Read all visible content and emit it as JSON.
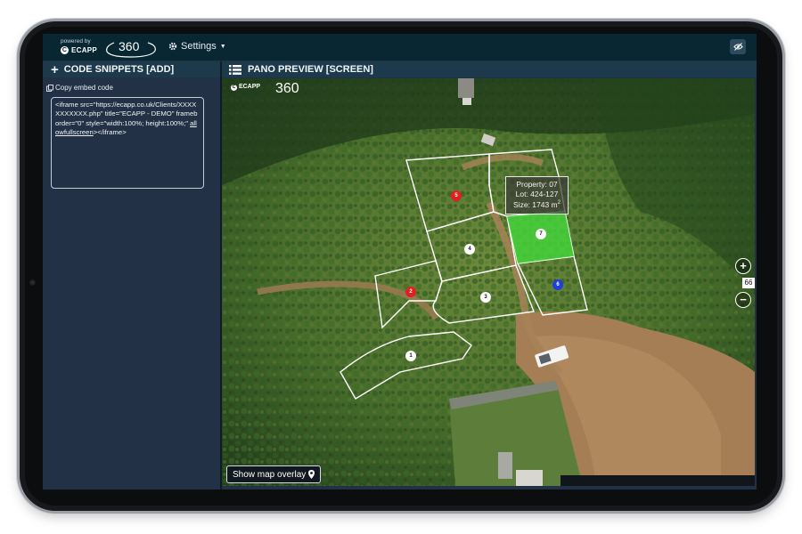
{
  "topbar": {
    "powered_by": "powered by",
    "brand": "ECAPP",
    "logo_text": "360",
    "settings_label": "Settings"
  },
  "left_panel": {
    "header": "CODE SNIPPETS [ADD]",
    "copy_label": "Copy embed code",
    "code_text_part1": "<iframe src=\"https://ecapp.co.uk/Clients/XXXXXXXXXXX.php\" title=\"ECAPP - DEMO\" frameborder=\"0\" style=\"width:100%; height:100%;\" ",
    "code_text_link": "allowfullscreen",
    "code_text_part2": "></iframe>"
  },
  "right_panel": {
    "header": "PANO PREVIEW [SCREEN]",
    "watermark_brand": "ECAPP",
    "watermark_360": "360",
    "tooltip": {
      "property": "Property: 07",
      "lot": "Lot: 424-127",
      "size": "Size: 1743 m",
      "size_sup": "2"
    },
    "zoom_value": "66",
    "overlay_button": "Show map overlay",
    "lots": [
      {
        "number": "1",
        "color": "#ffffff"
      },
      {
        "number": "2",
        "color": "#e02020"
      },
      {
        "number": "3",
        "color": "#ffffff"
      },
      {
        "number": "4",
        "color": "#ffffff"
      },
      {
        "number": "5",
        "color": "#e02020"
      },
      {
        "number": "6",
        "color": "#1f3fd6"
      },
      {
        "number": "7",
        "color": "#ffffff"
      }
    ]
  },
  "colors": {
    "topbar": "#082732",
    "panel": "#233147",
    "header": "#1c3a4c",
    "highlight_lot": "#45d23a"
  }
}
